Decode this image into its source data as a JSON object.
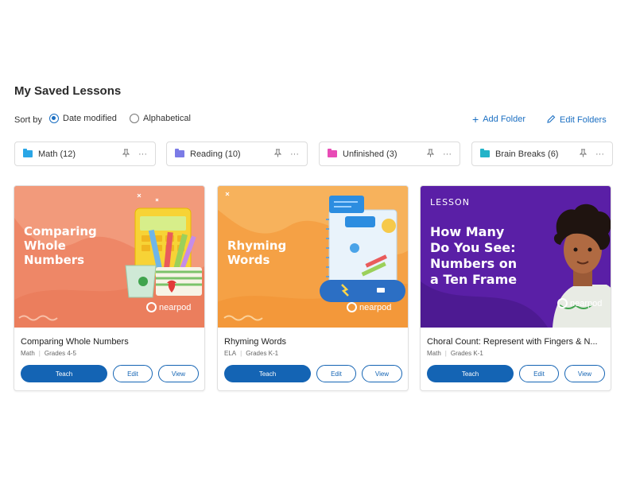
{
  "page": {
    "title": "My Saved Lessons"
  },
  "sort": {
    "label": "Sort by",
    "options": [
      {
        "label": "Date modified",
        "selected": true
      },
      {
        "label": "Alphabetical",
        "selected": false
      }
    ]
  },
  "actions": {
    "add_folder": "Add Folder",
    "edit_folders": "Edit Folders"
  },
  "folders": [
    {
      "name": "Math (12)",
      "color": "#2aa6e6",
      "icon": "folder-icon"
    },
    {
      "name": "Reading (10)",
      "color": "#7b7be6",
      "icon": "folder-icon"
    },
    {
      "name": "Unfinished (3)",
      "color": "#e84bb6",
      "icon": "folder-icon"
    },
    {
      "name": "Brain Breaks (6)",
      "color": "#22b3c8",
      "icon": "folder-icon"
    }
  ],
  "lessons": [
    {
      "thumb_title": "Comparing\nWhole\nNumbers",
      "brand": "nearpod",
      "title": "Comparing Whole Numbers",
      "subject": "Math",
      "grades": "Grades 4-5",
      "teach": "Teach",
      "edit": "Edit",
      "view": "View",
      "bg": "#ee8767"
    },
    {
      "thumb_title": "Rhyming\nWords",
      "brand": "nearpod",
      "title": "Rhyming Words",
      "subject": "ELA",
      "grades": "Grades K-1",
      "teach": "Teach",
      "edit": "Edit",
      "view": "View",
      "bg": "#f5a145"
    },
    {
      "thumb_tag": "LESSON",
      "thumb_title": "How Many\nDo You See:\nNumbers on\na Ten Frame",
      "brand": "nearpod",
      "title": "Choral Count: Represent with Fingers & N...",
      "subject": "Math",
      "grades": "Grades K-1",
      "teach": "Teach",
      "edit": "Edit",
      "view": "View",
      "bg": "#5a1fa6"
    }
  ],
  "colors": {
    "accent": "#1464b4",
    "link": "#1b6fc2"
  }
}
